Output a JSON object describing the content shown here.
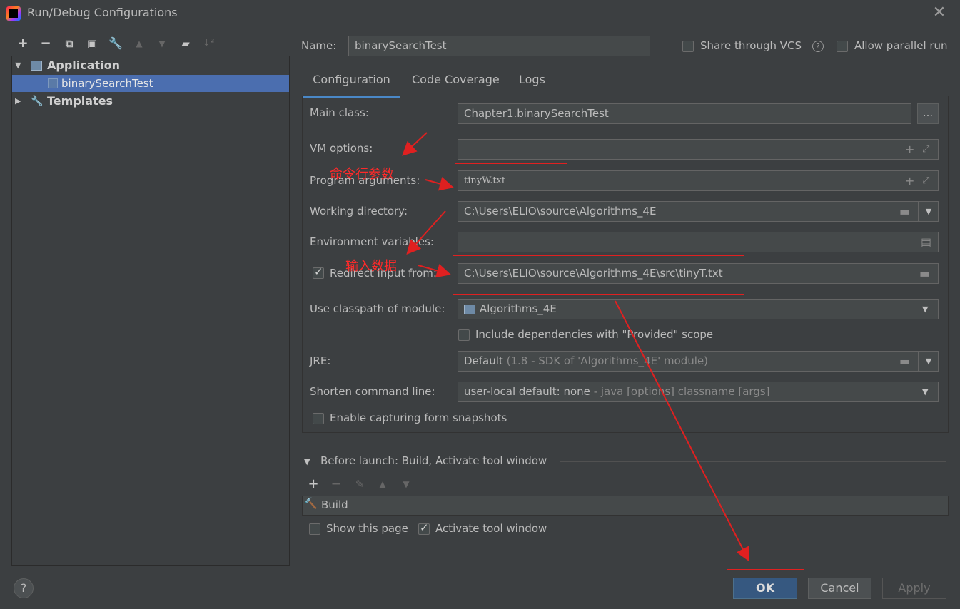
{
  "window": {
    "title": "Run/Debug Configurations"
  },
  "tree": {
    "application": "Application",
    "config": "binarySearchTest",
    "templates": "Templates"
  },
  "header": {
    "name_label": "Name:",
    "name_value": "binarySearchTest",
    "share_vcs": "Share through VCS",
    "parallel_run": "Allow parallel run"
  },
  "tabs": [
    "Configuration",
    "Code Coverage",
    "Logs"
  ],
  "config": {
    "main_class_label": "Main class:",
    "main_class_value": "Chapter1.binarySearchTest",
    "browse_label": "...",
    "vm_options_label": "VM options:",
    "program_args_label": "Program arguments:",
    "program_args_value": "tinyW.txt",
    "working_dir_label": "Working directory:",
    "working_dir_value": "C:\\Users\\ELIO\\source\\Algorithms_4E",
    "env_vars_label": "Environment variables:",
    "redirect_label": "Redirect input from:",
    "redirect_value": "C:\\Users\\ELIO\\source\\Algorithms_4E\\src\\tinyT.txt",
    "classpath_label": "Use classpath of module:",
    "classpath_value": "Algorithms_4E",
    "include_deps": "Include dependencies with \"Provided\" scope",
    "jre_label": "JRE:",
    "jre_value": "Default",
    "jre_hint": "(1.8 - SDK of 'Algorithms_4E' module)",
    "shorten_label": "Shorten command line:",
    "shorten_value": "user-local default: none",
    "shorten_hint": "- java [options] classname [args]",
    "snapshots": "Enable capturing form snapshots"
  },
  "before_launch": {
    "title": "Before launch: Build, Activate tool window",
    "item": "Build",
    "show_page": "Show this page",
    "activate_tool": "Activate tool window"
  },
  "buttons": {
    "help": "?",
    "ok": "OK",
    "cancel": "Cancel",
    "apply": "Apply"
  },
  "annotations": {
    "cmd_args": "命令行参数",
    "input_data": "输入数据"
  },
  "colors": {
    "accent": "#4a88c7",
    "selection": "#4b6eaf",
    "annotation": "#e02020",
    "background": "#3c3f41"
  }
}
